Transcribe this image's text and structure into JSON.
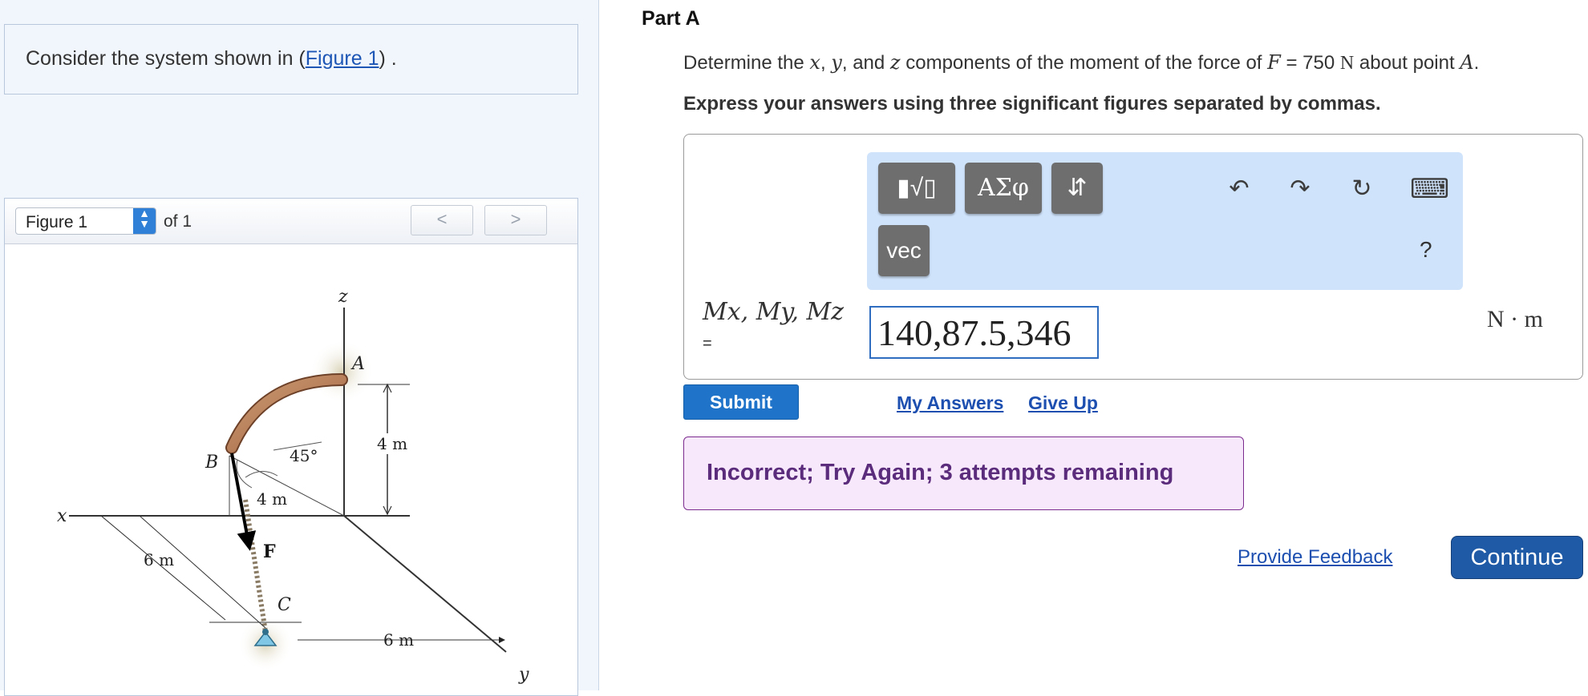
{
  "left": {
    "intro_prefix": "Consider the system shown in (",
    "intro_link": "Figure 1",
    "intro_suffix": ") .",
    "figure_select": "Figure 1",
    "of_label": "of 1",
    "prev_glyph": "<",
    "next_glyph": ">"
  },
  "figure": {
    "axis_x": "x",
    "axis_y": "y",
    "axis_z": "z",
    "point_a": "A",
    "point_b": "B",
    "point_c": "C",
    "force": "F",
    "angle": "45°",
    "dim_4m_vert": "4 m",
    "dim_4m_diag": "4 m",
    "dim_6m_x": "6 m",
    "dim_6m_y": "6 m"
  },
  "part": {
    "title": "Part A",
    "q_prefix": "Determine the ",
    "q_x": "x",
    "q_sep1": ", ",
    "q_y": "y",
    "q_sep2": ", and ",
    "q_z": "z",
    "q_mid": " components of the moment of the force of ",
    "q_F": "F",
    "q_eq": " = 750 ",
    "q_unit": "N",
    "q_about": " about point ",
    "q_A": "A",
    "q_end": ".",
    "instruction": "Express your answers using three significant figures separated by commas."
  },
  "toolbar": {
    "templates_label": "▮√▯",
    "greek_label": "ΑΣφ",
    "updown_label": "⇵",
    "vec_label": "vec",
    "undo_glyph": "↶",
    "redo_glyph": "↷",
    "reset_glyph": "↻",
    "keyboard_glyph": "⌨",
    "help_label": "?"
  },
  "answer": {
    "label": "Mx, My, Mz",
    "eq": "=",
    "value": "140,87.5,346",
    "unit": "N · m"
  },
  "actions": {
    "submit": "Submit",
    "my_answers": "My Answers",
    "give_up": "Give Up",
    "feedback": "Incorrect; Try Again; 3 attempts remaining",
    "provide_feedback": "Provide Feedback",
    "continue": "Continue"
  },
  "colors": {
    "accent": "#1f74c9",
    "toolbar_bg": "#cfe3fb",
    "feedback_border": "#7b2b8e",
    "feedback_text": "#5b2c7c"
  }
}
